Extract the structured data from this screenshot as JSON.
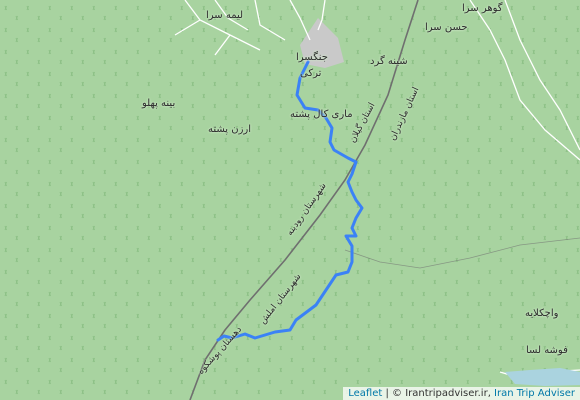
{
  "map": {
    "labels": [
      {
        "id": "lime-sara",
        "text": "لیمه سرا"
      },
      {
        "id": "gohar-sara",
        "text": "گوهر سرا"
      },
      {
        "id": "hasan-sara",
        "text": "حسن سرا"
      },
      {
        "id": "jangal-sara",
        "text": "جنگسرا"
      },
      {
        "id": "tarki",
        "text": "ترکی"
      },
      {
        "id": "shineh-gerd",
        "text": "شینه گرد"
      },
      {
        "id": "bineh-pahlu",
        "text": "بینه پهلو"
      },
      {
        "id": "mari-kal-poshteh",
        "text": "ماری کال پشته"
      },
      {
        "id": "arzan-poshteh",
        "text": "ارزن پشته"
      },
      {
        "id": "vachkolaieh",
        "text": "واچکلایه"
      },
      {
        "id": "fusheh-lesa",
        "text": "فوشه لسا"
      },
      {
        "id": "road-ostan-gilan",
        "text": "استان گیلان"
      },
      {
        "id": "road-dehestan-vardasht",
        "text": "شهرستان رودبنه"
      },
      {
        "id": "road-ostan-mazandaran",
        "text": "استان مازندران"
      },
      {
        "id": "road-dehestan-amlash",
        "text": "شهرستان املش"
      },
      {
        "id": "road-dehestan-poshtkuh",
        "text": "دهستان پوشکوه"
      }
    ],
    "route_color": "#3b82f6",
    "colors": {
      "forest": "#a8d3a0",
      "road": "#6f6f6f",
      "stream": "#ffffff",
      "urban": "#c9c9c9"
    }
  },
  "attribution": {
    "leaflet": "Leaflet",
    "separator": " | © ",
    "source": "Irantripadviser.ir",
    "comma": ", ",
    "brand": "Iran Trip Adviser"
  }
}
